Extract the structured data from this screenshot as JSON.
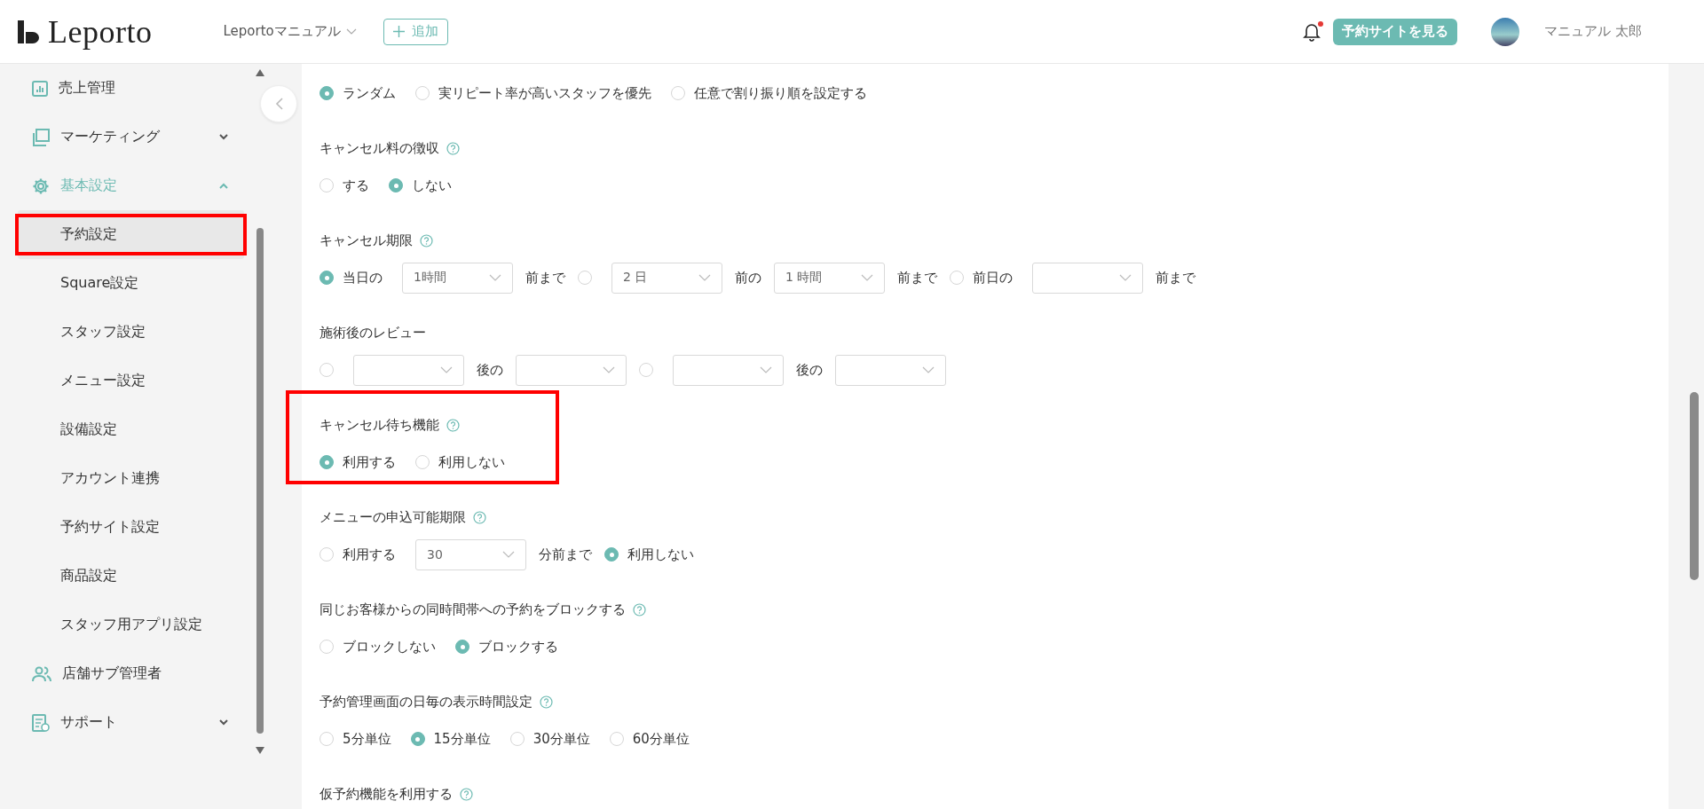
{
  "header": {
    "logo": "Leporto",
    "store": "Leportoマニュアル",
    "add_button": "追加",
    "notification_unread": true,
    "site_button": "予約サイトを見る",
    "user_name": "マニュアル 太郎"
  },
  "sidebar": {
    "items": [
      {
        "label": "売上管理"
      },
      {
        "label": "マーケティング",
        "expanded": false
      },
      {
        "label": "基本設定",
        "expanded": true,
        "children": [
          {
            "label": "予約設定",
            "selected": true,
            "highlighted": true
          },
          {
            "label": "Square設定",
            "selected": false
          },
          {
            "label": "スタッフ設定",
            "selected": false
          },
          {
            "label": "メニュー設定",
            "selected": false
          },
          {
            "label": "設備設定",
            "selected": false
          },
          {
            "label": "アカウント連携",
            "selected": false
          },
          {
            "label": "予約サイト設定",
            "selected": false
          },
          {
            "label": "商品設定",
            "selected": false
          },
          {
            "label": "スタッフ用アプリ設定",
            "selected": false
          }
        ]
      },
      {
        "label": "店舗サブ管理者"
      },
      {
        "label": "サポート",
        "expanded": false
      }
    ]
  },
  "sections": [
    {
      "help": false,
      "options": [
        {
          "kind": "radio",
          "label": "ランダム",
          "selected": true
        },
        {
          "kind": "radio",
          "label": "実リピート率が高いスタッフを優先",
          "selected": false
        },
        {
          "kind": "radio",
          "label": "任意で割り振り順を設定する",
          "selected": false
        }
      ]
    },
    {
      "title": "キャンセル料の徴収",
      "help": true,
      "options": [
        {
          "kind": "radio",
          "label": "する",
          "selected": false
        },
        {
          "kind": "radio",
          "label": "しない",
          "selected": true
        }
      ]
    },
    {
      "title": "キャンセル期限",
      "help": true,
      "options": [
        {
          "kind": "radio",
          "label": "当日の",
          "selected": true
        },
        {
          "kind": "select",
          "value": "1時間"
        },
        {
          "kind": "text",
          "text": "前まで"
        },
        {
          "kind": "radio",
          "selected": false
        },
        {
          "kind": "select",
          "value": "2 日"
        },
        {
          "kind": "text",
          "text": "前の"
        },
        {
          "kind": "select",
          "value": "1 時間"
        },
        {
          "kind": "text",
          "text": "前まで"
        },
        {
          "kind": "radio",
          "label": "前日の",
          "selected": false
        },
        {
          "kind": "select"
        },
        {
          "kind": "text",
          "text": "前まで"
        }
      ]
    },
    {
      "title": "施術後のレビュー",
      "help": false,
      "options": [
        {
          "kind": "radio",
          "selected": false
        },
        {
          "kind": "select"
        },
        {
          "kind": "text",
          "text": "後の"
        },
        {
          "kind": "select"
        },
        {
          "kind": "radio",
          "selected": false
        },
        {
          "kind": "select"
        },
        {
          "kind": "text",
          "text": "後の"
        },
        {
          "kind": "select"
        }
      ]
    },
    {
      "title": "キャンセル待ち機能",
      "help": true,
      "highlighted": true,
      "options": [
        {
          "kind": "radio",
          "label": "利用する",
          "selected": true
        },
        {
          "kind": "radio",
          "label": "利用しない",
          "selected": false
        }
      ]
    },
    {
      "title": "メニューの申込可能期限",
      "help": true,
      "options": [
        {
          "kind": "radio",
          "label": "利用する",
          "selected": false
        },
        {
          "kind": "select",
          "value": "30"
        },
        {
          "kind": "text",
          "text": "分前まで"
        },
        {
          "kind": "radio",
          "label": "利用しない",
          "selected": true
        }
      ]
    },
    {
      "title": "同じお客様からの同時間帯への予約をブロックする",
      "help": true,
      "options": [
        {
          "kind": "radio",
          "label": "ブロックしない",
          "selected": false
        },
        {
          "kind": "radio",
          "label": "ブロックする",
          "selected": true
        }
      ]
    },
    {
      "title": "予約管理画面の日毎の表示時間設定",
      "help": true,
      "options": [
        {
          "kind": "radio",
          "label": "5分単位",
          "selected": false
        },
        {
          "kind": "radio",
          "label": "15分単位",
          "selected": true
        },
        {
          "kind": "radio",
          "label": "30分単位",
          "selected": false
        },
        {
          "kind": "radio",
          "label": "60分単位",
          "selected": false
        }
      ]
    },
    {
      "title": "仮予約機能を利用する",
      "help": true
    }
  ]
}
